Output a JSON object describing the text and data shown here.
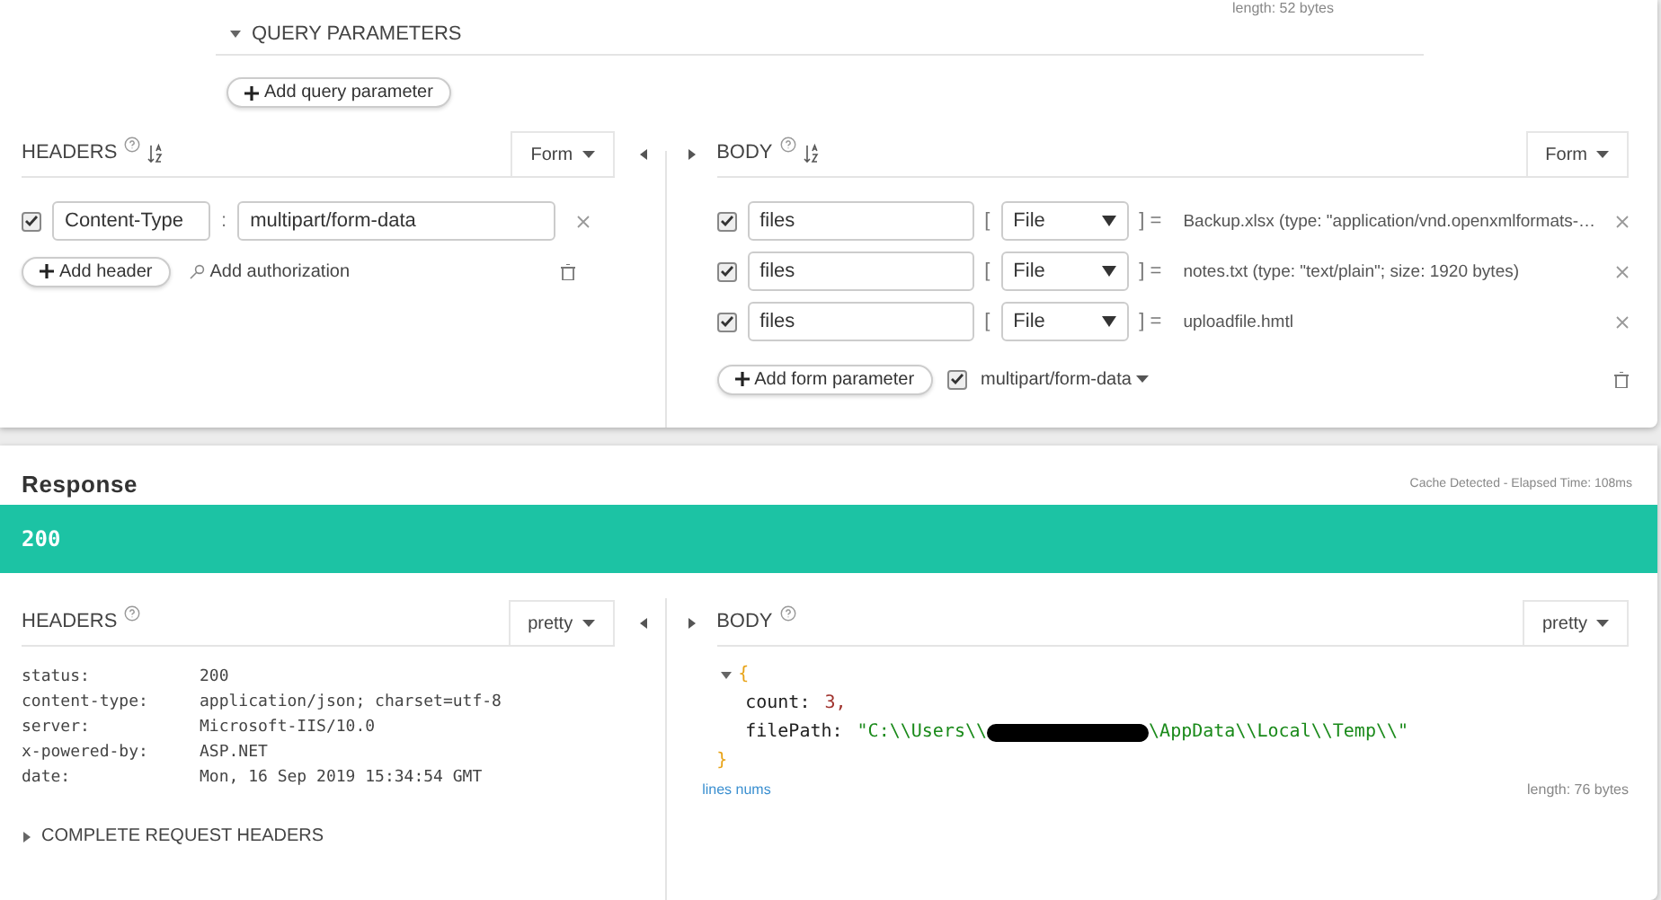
{
  "query_parameters": {
    "length": "length: 52 bytes",
    "title": "QUERY PARAMETERS",
    "expanded": true,
    "add_button": "Add query parameter"
  },
  "request_headers": {
    "title": "HEADERS",
    "mode": "Form",
    "rows": [
      {
        "checked": true,
        "name": "Content-Type",
        "separator": ":",
        "value": "multipart/form-data"
      }
    ],
    "add_button": "Add header",
    "auth_link": "Add authorization"
  },
  "request_body": {
    "title": "BODY",
    "mode": "Form",
    "rows": [
      {
        "checked": true,
        "name": "files",
        "open_bracket": "[",
        "type": "File",
        "close_bracket": "] =",
        "value": "Backup.xlsx (type: \"application/vnd.openxmlformats-…"
      },
      {
        "checked": true,
        "name": "files",
        "open_bracket": "[",
        "type": "File",
        "close_bracket": "] =",
        "value": "notes.txt (type: \"text/plain\"; size: 1920 bytes)"
      },
      {
        "checked": true,
        "name": "files",
        "open_bracket": "[",
        "type": "File",
        "close_bracket": "] =",
        "value": "uploadfile.hmtl"
      }
    ],
    "add_button": "Add form parameter",
    "encoding": {
      "checked": true,
      "label": "multipart/form-data"
    }
  },
  "response": {
    "title": "Response",
    "cache_note": "Cache Detected - Elapsed Time: 108ms",
    "status": "200",
    "headers": {
      "title": "HEADERS",
      "mode": "pretty",
      "rows": [
        {
          "key": "status:",
          "value": "200"
        },
        {
          "key": "content-type:",
          "value": "application/json; charset=utf-8"
        },
        {
          "key": "server:",
          "value": "Microsoft-IIS/10.0"
        },
        {
          "key": "x-powered-by:",
          "value": "ASP.NET"
        },
        {
          "key": "date:",
          "value": "Mon, 16 Sep 2019 15:34:54 GMT"
        }
      ],
      "complete_toggle": "COMPLETE REQUEST HEADERS"
    },
    "body": {
      "title": "BODY",
      "mode": "pretty",
      "expanded": true,
      "open_brace": "{",
      "close_brace": "}",
      "entries": [
        {
          "kind": "number",
          "key": "count:",
          "value": "3",
          "punct": ","
        },
        {
          "kind": "string",
          "key": "filePath:",
          "value": "\"C:\\\\Users\\\\",
          "redacted": true,
          "value_end": "\\AppData\\\\Local\\\\Temp\\\\\""
        }
      ],
      "lines_link": "lines nums",
      "length": "length: 76 bytes"
    }
  }
}
